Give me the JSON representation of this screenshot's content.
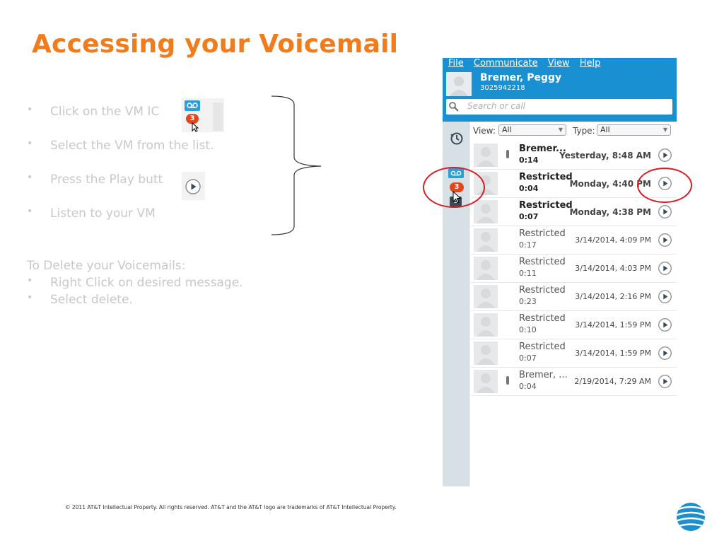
{
  "slide": {
    "title": "Accessing your Voicemail",
    "steps": [
      "Click on the VM IC",
      "Select the VM from the list.",
      "Press the Play butt",
      "Listen to your VM"
    ],
    "delete_heading": "To Delete your Voicemails:",
    "delete_steps": [
      "Right Click on desired message.",
      "Select delete."
    ],
    "bullet": "•",
    "vm_badge_count": "3",
    "footer": "© 2011 AT&T Intellectual Property. All rights reserved. AT&T and the AT&T logo are trademarks of AT&T Intellectual Property."
  },
  "app": {
    "menu": [
      "File",
      "Communicate",
      "View",
      "Help"
    ],
    "user": {
      "name": "Bremer, Peggy",
      "number": "3025942218"
    },
    "search_placeholder": "Search or call",
    "sidebar": {
      "vm_count": "3",
      "other_label": "3"
    },
    "filters": {
      "view_label": "View:",
      "view_value": "All",
      "type_label": "Type:",
      "type_value": "All"
    },
    "voicemails": [
      {
        "name": "Bremer...",
        "duration": "0:14",
        "time": "Yesterday, 8:48 AM",
        "unread": true,
        "marker": true
      },
      {
        "name": "Restricted",
        "duration": "0:04",
        "time": "Monday, 4:40 PM",
        "unread": true,
        "marker": false
      },
      {
        "name": "Restricted",
        "duration": "0:07",
        "time": "Monday, 4:38 PM",
        "unread": true,
        "marker": false
      },
      {
        "name": "Restricted",
        "duration": "0:17",
        "time": "3/14/2014, 4:09 PM",
        "unread": false,
        "marker": false
      },
      {
        "name": "Restricted",
        "duration": "0:11",
        "time": "3/14/2014, 4:03 PM",
        "unread": false,
        "marker": false
      },
      {
        "name": "Restricted",
        "duration": "0:23",
        "time": "3/14/2014, 2:16 PM",
        "unread": false,
        "marker": false
      },
      {
        "name": "Restricted",
        "duration": "0:10",
        "time": "3/14/2014, 1:59 PM",
        "unread": false,
        "marker": false
      },
      {
        "name": "Restricted",
        "duration": "0:07",
        "time": "3/14/2014, 1:59 PM",
        "unread": false,
        "marker": false
      },
      {
        "name": "Bremer, ...",
        "duration": "0:04",
        "time": "2/19/2014, 7:29 AM",
        "unread": false,
        "marker": true
      }
    ]
  },
  "colors": {
    "title": "#f07c1d",
    "header": "#1890d2",
    "badge": "#e4461b",
    "annotation": "#d41f26"
  },
  "icons": {
    "globe": "att-globe-logo",
    "play": "play-icon",
    "voicemail": "voicemail-icon"
  }
}
